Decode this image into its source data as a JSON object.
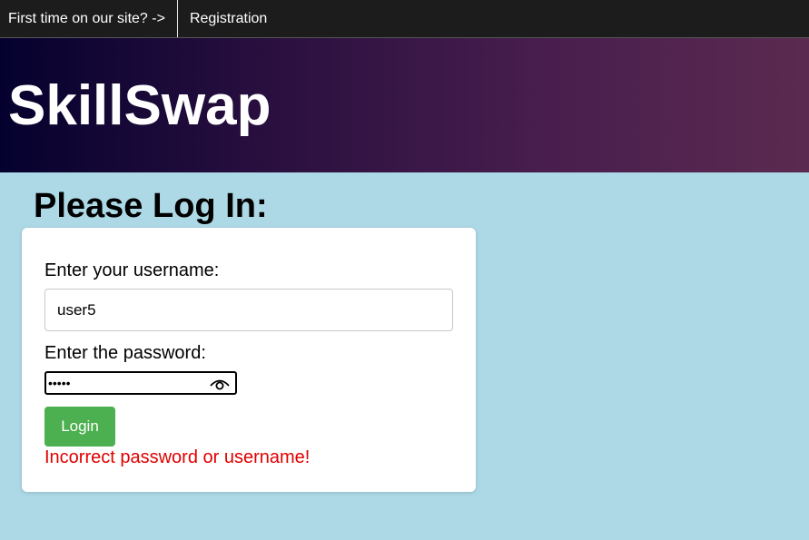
{
  "nav": {
    "prompt": "First time on our site? ->",
    "registration_link": "Registration"
  },
  "banner": {
    "brand": "SkillSwap"
  },
  "page": {
    "heading": "Please Log In:"
  },
  "login_form": {
    "username_label": "Enter your username:",
    "username_value": "user5",
    "password_label": "Enter the password:",
    "password_value": "user5",
    "password_toggle_icon": "eye-icon",
    "login_button_label": "Login",
    "error_message": "Incorrect password or username!"
  },
  "colors": {
    "nav_background": "#1c1c1c",
    "page_background": "#add8e6",
    "banner_gradient_start": "#05012e",
    "banner_gradient_end": "#5b2a50",
    "login_button": "#4caf50",
    "error_text": "#e00000"
  }
}
